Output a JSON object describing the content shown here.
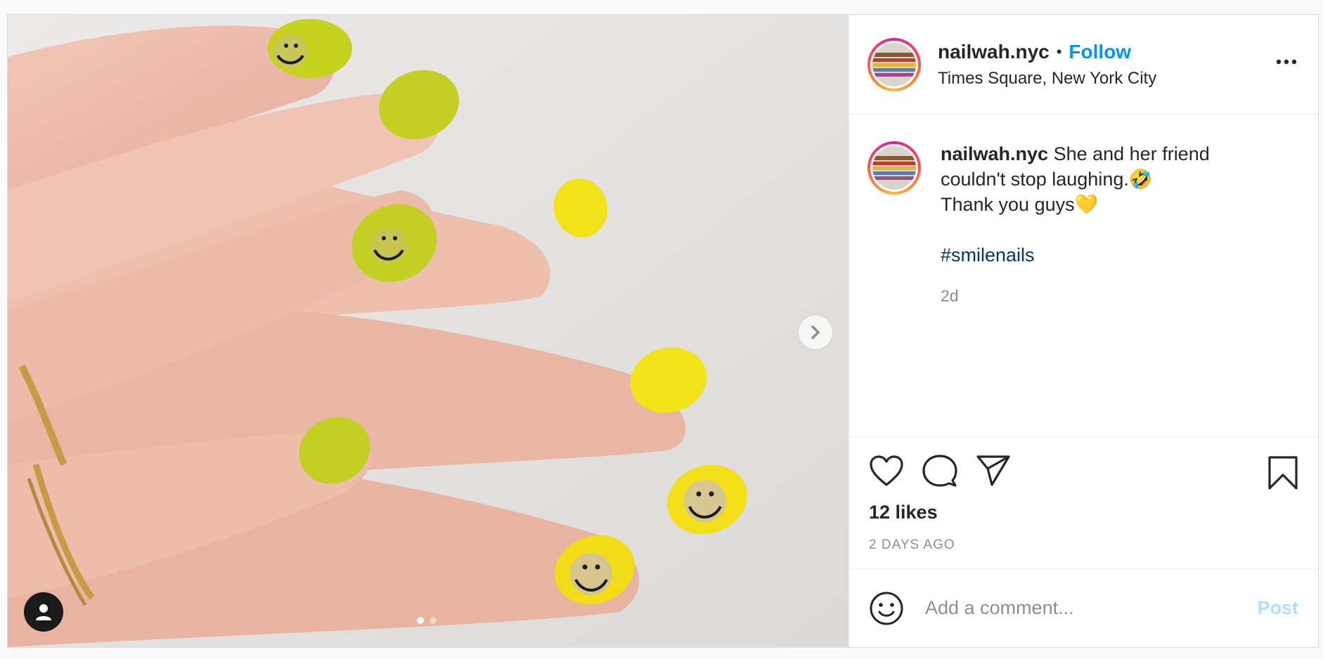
{
  "post": {
    "media": {
      "description_icon": "nail-art-photo",
      "carousel_count": 2,
      "carousel_active": 1
    },
    "header": {
      "username": "nailwah.nyc",
      "separator": "•",
      "follow_label": "Follow",
      "location": "Times Square, New York City"
    },
    "caption": {
      "username": "nailwah.nyc",
      "line1": "She and her friend couldn't stop laughing.🤣",
      "line2": "Thank you guys💛",
      "hashtag": "#smilenails",
      "age": "2d"
    },
    "actions": {
      "likes": "12 likes",
      "date": "2 DAYS AGO"
    },
    "comment_box": {
      "placeholder": "Add a comment...",
      "post_label": "Post"
    }
  },
  "colors": {
    "follow": "#0095f6",
    "hashtag": "#00376b",
    "post_disabled": "#b2dffc",
    "muted": "#8e8e8e"
  }
}
